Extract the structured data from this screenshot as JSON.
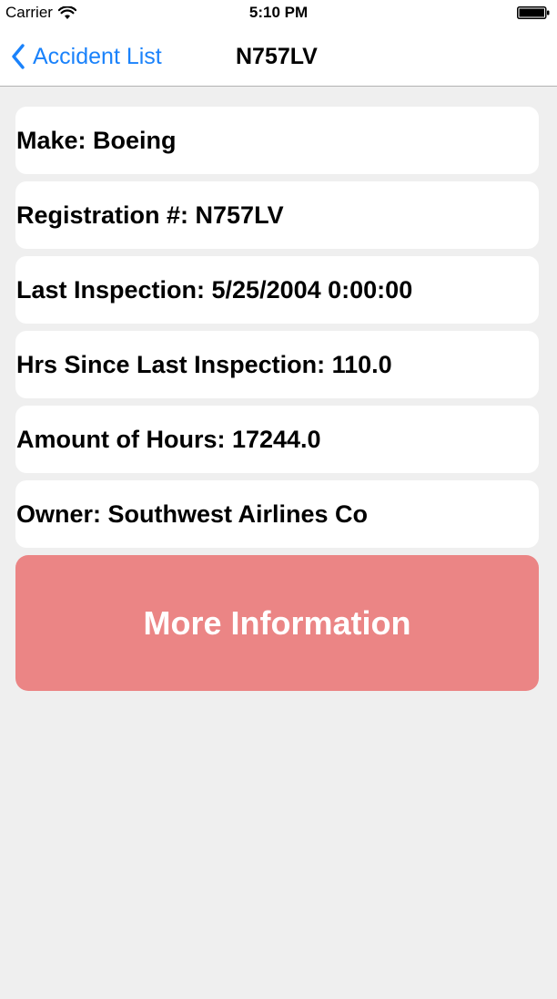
{
  "status_bar": {
    "carrier": "Carrier",
    "time": "5:10 PM",
    "icons": [
      "wifi-icon",
      "battery-icon"
    ]
  },
  "nav": {
    "back_label": "Accident List",
    "back_icon": "chevron-left-icon",
    "title": "N757LV"
  },
  "details": [
    {
      "text": "Make: Boeing"
    },
    {
      "text": "Registration #: N757LV"
    },
    {
      "text": "Last Inspection: 5/25/2004 0:00:00"
    },
    {
      "text": "Hrs Since Last Inspection: 110.0"
    },
    {
      "text": "Amount of Hours: 17244.0"
    },
    {
      "text": "Owner: Southwest Airlines Co"
    }
  ],
  "action_button": {
    "label": "More Information",
    "color": "#eb8585"
  },
  "colors": {
    "accent": "#1a82fb",
    "background": "#efefef"
  }
}
